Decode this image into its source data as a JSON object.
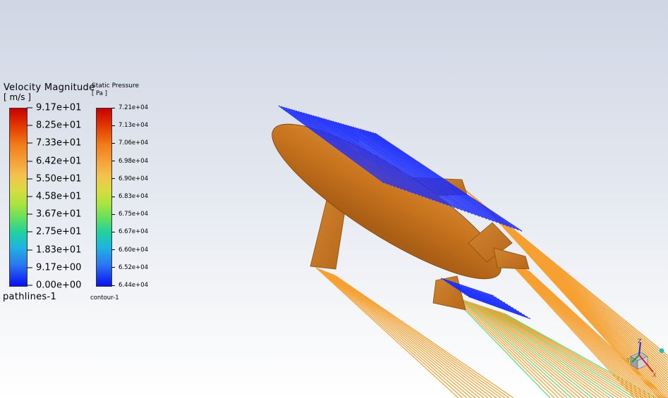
{
  "legends": {
    "velocity": {
      "title": "Velocity Magnitude",
      "unit": "[ m/s ]",
      "ticks": [
        "9.17e+01",
        "8.25e+01",
        "7.33e+01",
        "6.42e+01",
        "5.50e+01",
        "4.58e+01",
        "3.67e+01",
        "2.75e+01",
        "1.83e+01",
        "9.17e+00",
        "0.00e+00"
      ],
      "name": "pathlines-1"
    },
    "pressure": {
      "title": "Static Pressure",
      "unit": "[ Pa ]",
      "ticks": [
        "7.21e+04",
        "7.13e+04",
        "7.06e+04",
        "6.98e+04",
        "6.90e+04",
        "6.83e+04",
        "6.75e+04",
        "6.67e+04",
        "6.60e+04",
        "6.52e+04",
        "6.44e+04"
      ],
      "name": "contour-1"
    }
  },
  "colors": {
    "body": "#c8731e",
    "pathline_fast": "#f5a030",
    "pathline_slow": "#1a2cff",
    "pathline_mid": "#4de070"
  },
  "axis_triad": {
    "labels": [
      "Z",
      "Y",
      "X"
    ]
  }
}
